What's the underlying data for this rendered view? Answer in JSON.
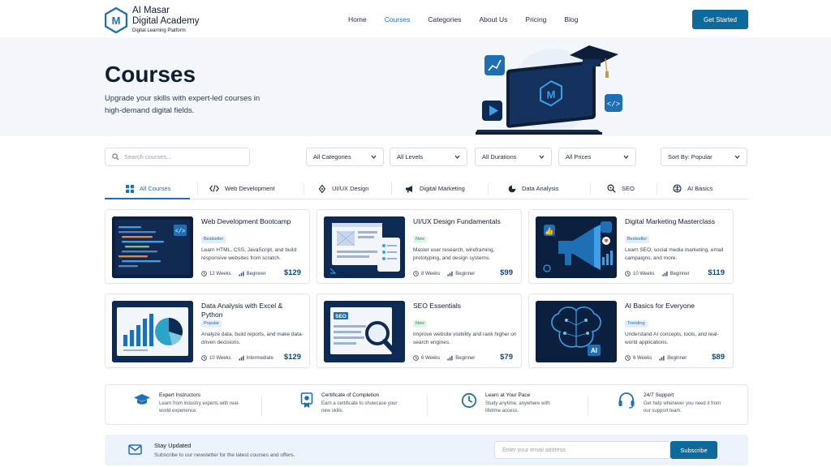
{
  "brand": {
    "name_line1": "AI Masar",
    "name_line2": "Digital Academy",
    "tagline": "Digital Learning Platform",
    "logo_letter": "M"
  },
  "nav": {
    "links": [
      "Home",
      "Courses",
      "Categories",
      "About Us",
      "Pricing",
      "Blog"
    ],
    "active": "Courses",
    "cta_label": "Get Started"
  },
  "hero": {
    "title": "Courses",
    "subtitle": "Upgrade your skills with expert-led courses in high-demand digital fields."
  },
  "filters": {
    "search_placeholder": "Search courses...",
    "categories": "All Categories",
    "levels": "All Levels",
    "durations": "All Durations",
    "prices": "All Prices",
    "sort": "Sort By: Popular"
  },
  "tabs": [
    {
      "label": "All Courses",
      "icon": "grid-icon"
    },
    {
      "label": "Web Development",
      "icon": "code-icon"
    },
    {
      "label": "UI/UX Design",
      "icon": "pen-tool-icon"
    },
    {
      "label": "Digital Marketing",
      "icon": "megaphone-icon"
    },
    {
      "label": "Data Analysis",
      "icon": "pie-chart-icon"
    },
    {
      "label": "SEO",
      "icon": "search-gear-icon"
    },
    {
      "label": "AI Basics",
      "icon": "ai-chip-icon"
    }
  ],
  "courses": [
    {
      "title": "Web Development Bootcamp",
      "badge": "Bestseller",
      "desc": "Learn HTML, CSS, JavaScript, and build responsive websites from scratch.",
      "duration": "12 Weeks",
      "level": "Beginner",
      "price": "$129"
    },
    {
      "title": "UI/UX Design Fundamentals",
      "badge": "New",
      "desc": "Master user research, wireframing, prototyping, and design systems.",
      "duration": "8 Weeks",
      "level": "Beginner",
      "price": "$99"
    },
    {
      "title": "Digital Marketing Masterclass",
      "badge": "Bestseller",
      "desc": "Learn SEO, social media marketing, email campaigns, and more.",
      "duration": "10 Weeks",
      "level": "Beginner",
      "price": "$119"
    },
    {
      "title": "Data Analysis with Excel & Python",
      "badge": "Popular",
      "desc": "Analyze data, build reports, and make data-driven decisions.",
      "duration": "10 Weeks",
      "level": "Intermediate",
      "price": "$129"
    },
    {
      "title": "SEO Essentials",
      "badge": "New",
      "desc": "Improve website visibility and rank higher on search engines.",
      "duration": "6 Weeks",
      "level": "Beginner",
      "price": "$79"
    },
    {
      "title": "AI Basics for Everyone",
      "badge": "Trending",
      "desc": "Understand AI concepts, tools, and real-world applications.",
      "duration": "6 Weeks",
      "level": "Beginner",
      "price": "$89"
    }
  ],
  "thumb_labels": {
    "seo": "SEO",
    "ai": "AI"
  },
  "features": [
    {
      "title": "Expert Instructors",
      "desc": "Learn from industry experts with real-world experience.",
      "icon": "graduation-cap-icon"
    },
    {
      "title": "Certificate of Completion",
      "desc": "Earn a certificate to showcase your new skills.",
      "icon": "certificate-icon"
    },
    {
      "title": "Learn at Your Pace",
      "desc": "Study anytime, anywhere with lifetime access.",
      "icon": "clock-icon"
    },
    {
      "title": "24/7 Support",
      "desc": "Get help whenever you need it from our support team.",
      "icon": "headset-icon"
    }
  ],
  "newsletter": {
    "title": "Stay Updated",
    "desc": "Subscribe to our newsletter for the latest courses and offers.",
    "placeholder": "Enter your email address",
    "button": "Subscribe"
  },
  "colors": {
    "primary": "#0f6a9c",
    "accent": "#1f6fb5",
    "navy": "#0d2a55",
    "badge_bestseller": "#e3eefb",
    "badge_new": "#e2f5ea",
    "badge_popular": "#e3eefb",
    "badge_trending": "#e3eefb"
  }
}
